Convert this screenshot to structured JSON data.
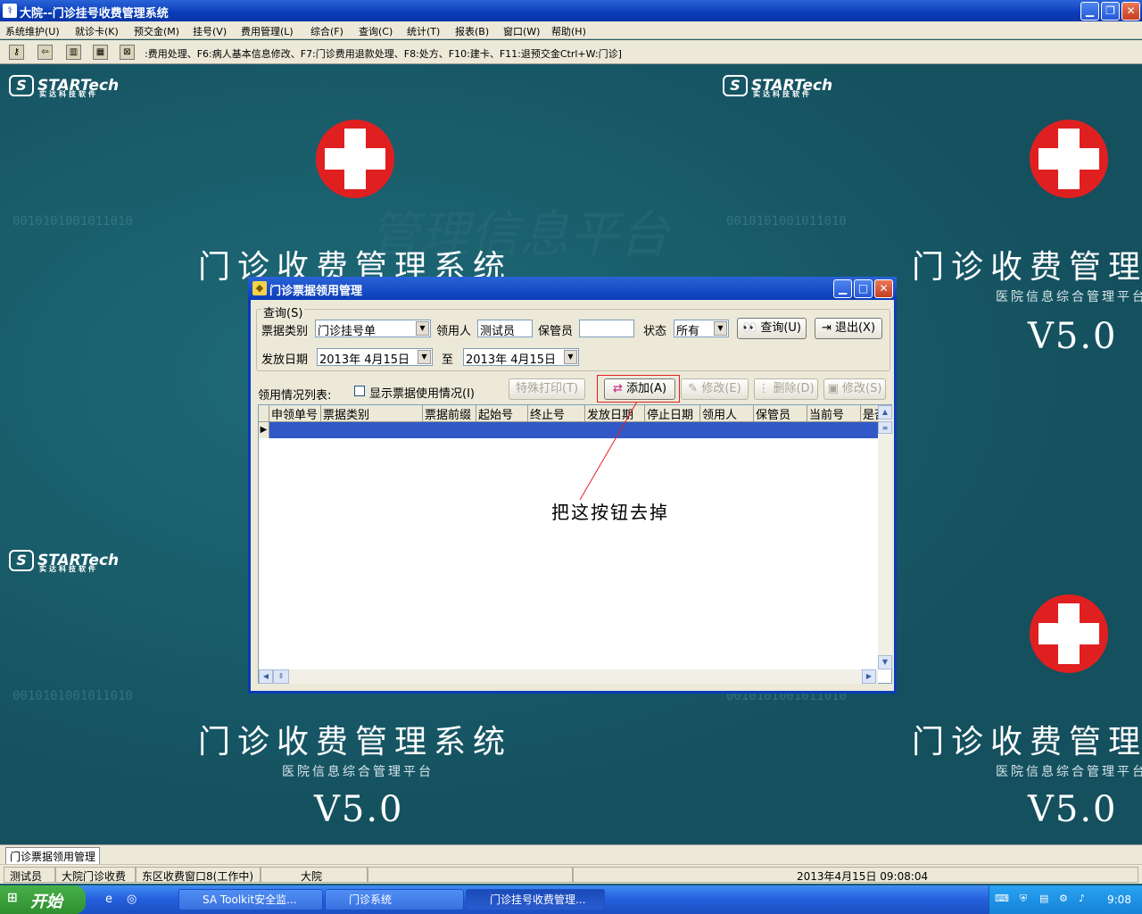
{
  "window": {
    "title": "大院--门诊挂号收费管理系统",
    "icon": "app-icon"
  },
  "menu": [
    "系统维护(U)",
    "就诊卡(K)",
    "预交金(M)",
    "挂号(V)",
    "费用管理(L)",
    "综合(F)",
    "查询(C)",
    "统计(T)",
    "报表(B)",
    "窗口(W)",
    "帮助(H)"
  ],
  "toolbar": {
    "hint": ":费用处理、F6:病人基本信息修改、F7:门诊费用退款处理、F8:处方、F10:建卡、F11:退预交金Ctrl+W:门诊]"
  },
  "background": {
    "logo_text": "STARTech",
    "logo_sub": "实达科技软件",
    "title": "门诊收费管理系统",
    "subtitle": "医院信息综合管理平台",
    "version": "V5.0",
    "watermark": "管理信息平台",
    "binary": "0010101001011010"
  },
  "dialog": {
    "title": "门诊票据领用管理",
    "query_group": "查询(S)",
    "labels": {
      "ticket_type": "票据类别",
      "receiver": "领用人",
      "keeper": "保管员",
      "state": "状态",
      "issue_date": "发放日期",
      "to": "至",
      "list": "领用情况列表:",
      "show_usage": "显示票据使用情况(I)"
    },
    "values": {
      "ticket_type": "门诊挂号单",
      "receiver": "测试员",
      "keeper": "",
      "state": "所有",
      "date_from": "2013年 4月15日",
      "date_to": "2013年 4月15日"
    },
    "buttons": {
      "query": "查询(U)",
      "exit": "退出(X)",
      "special_print": "特殊打印(T)",
      "add": "添加(A)",
      "modify": "修改(E)",
      "delete": "删除(D)",
      "modify2": "修改(S)"
    },
    "columns": [
      "申领单号",
      "票据类别",
      "票据前缀",
      "起始号",
      "终止号",
      "发放日期",
      "停止日期",
      "领用人",
      "保管员",
      "当前号",
      "是否"
    ]
  },
  "annotation": {
    "text": "把这按钮去掉",
    "color": "#e02020"
  },
  "window_tab": "门诊票据领用管理",
  "status": [
    "测试员",
    "大院门诊收费",
    "东区收费窗口8(工作中)",
    "大院",
    "",
    "2013年4月15日 09:08:04"
  ],
  "taskbar": {
    "start": "开始",
    "tasks": [
      "SA Toolkit安全监...",
      "门诊系统",
      "门诊挂号收费管理..."
    ],
    "clock": "9:08"
  }
}
